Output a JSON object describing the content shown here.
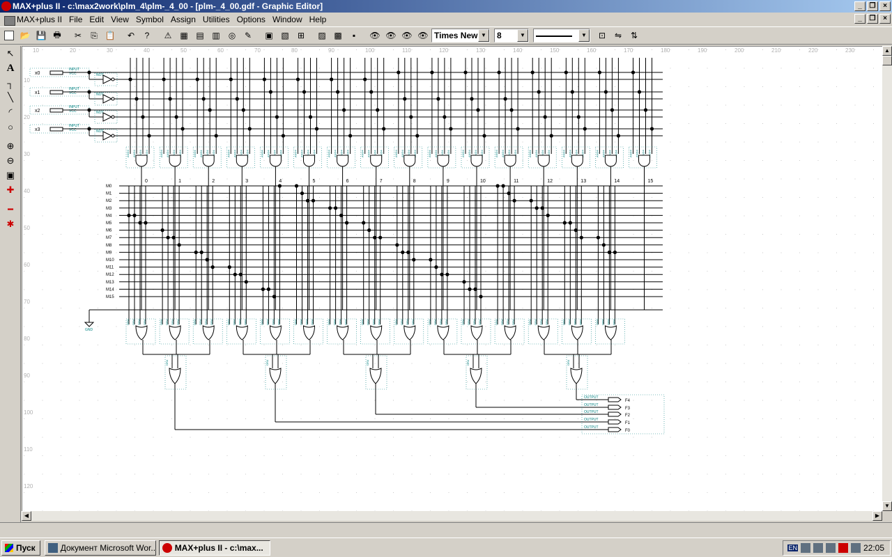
{
  "window": {
    "title": "MAX+plus II - c:\\max2work\\plm_4\\plm-_4_00 - [plm-_4_00.gdf - Graphic Editor]"
  },
  "menu": [
    "MAX+plus II",
    "File",
    "Edit",
    "View",
    "Symbol",
    "Assign",
    "Utilities",
    "Options",
    "Window",
    "Help"
  ],
  "toolbar": {
    "font_name": "Times New",
    "font_size": "8"
  },
  "ruler": {
    "top": [
      "10",
      "20",
      "30",
      "40",
      "50",
      "60",
      "70",
      "80",
      "90",
      "100",
      "110",
      "120",
      "130",
      "140",
      "150",
      "160",
      "170",
      "180",
      "190",
      "200",
      "210",
      "220",
      "230"
    ],
    "left": [
      "10",
      "20",
      "30",
      "40",
      "50",
      "60",
      "70",
      "80",
      "90",
      "100",
      "110",
      "120"
    ]
  },
  "schematic": {
    "inputs": [
      "x0",
      "x1",
      "x2",
      "x3"
    ],
    "input_prim": "INPUT",
    "input_vcc": "VCC",
    "not_label": "NOT",
    "and_label": "AND4",
    "or_label": "OR4",
    "product_terms": [
      "0",
      "1",
      "2",
      "3",
      "4",
      "5",
      "6",
      "7",
      "8",
      "9",
      "10",
      "11",
      "12",
      "13",
      "14",
      "15"
    ],
    "minterms": [
      "M0",
      "M1",
      "M2",
      "M3",
      "M4",
      "M5",
      "M6",
      "M7",
      "M8",
      "M9",
      "M10",
      "M11",
      "M12",
      "M13",
      "M14",
      "M15"
    ],
    "gnd_label": "GND",
    "outputs": [
      "F4",
      "F3",
      "F2",
      "F1",
      "F0"
    ],
    "output_prim": "OUTPUT"
  },
  "taskbar": {
    "start": "Пуск",
    "tasks": [
      "Документ Microsoft Wor...",
      "MAX+plus II - c:\\max..."
    ],
    "lang": "EN",
    "clock": "22:05"
  }
}
